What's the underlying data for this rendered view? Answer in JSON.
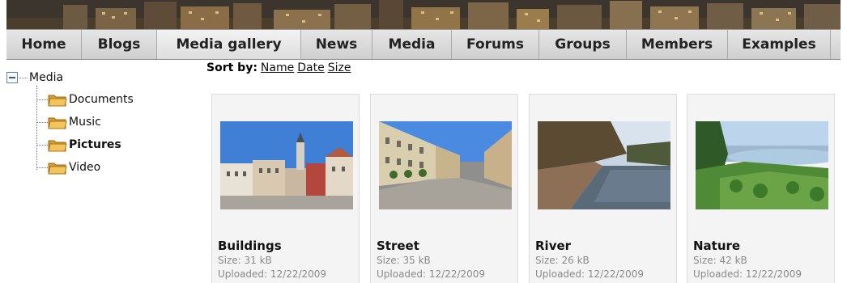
{
  "nav": {
    "items": [
      {
        "label": "Home"
      },
      {
        "label": "Blogs"
      },
      {
        "label": "Media gallery",
        "active": true
      },
      {
        "label": "News"
      },
      {
        "label": "Media"
      },
      {
        "label": "Forums"
      },
      {
        "label": "Groups"
      },
      {
        "label": "Members"
      },
      {
        "label": "Examples"
      }
    ]
  },
  "tree": {
    "root": "Media",
    "children": [
      "Documents",
      "Music",
      "Pictures",
      "Video"
    ],
    "selected": "Pictures"
  },
  "sort": {
    "label": "Sort by:",
    "options": [
      "Name",
      "Date",
      "Size"
    ]
  },
  "gallery": [
    {
      "title": "Buildings",
      "size": "Size: 31 kB",
      "uploaded": "Uploaded: 12/22/2009"
    },
    {
      "title": "Street",
      "size": "Size: 35 kB",
      "uploaded": "Uploaded: 12/22/2009"
    },
    {
      "title": "River",
      "size": "Size: 26 kB",
      "uploaded": "Uploaded: 12/22/2009"
    },
    {
      "title": "Nature",
      "size": "Size: 42 kB",
      "uploaded": "Uploaded: 12/22/2009"
    }
  ],
  "colors": {
    "nav_bg": "#d9d9d9",
    "folder": "#e8b84a",
    "tree_toggle": "#2a5aa6"
  },
  "icons": {
    "tree_toggle": "minus-box-icon",
    "folder": "folder-icon"
  }
}
